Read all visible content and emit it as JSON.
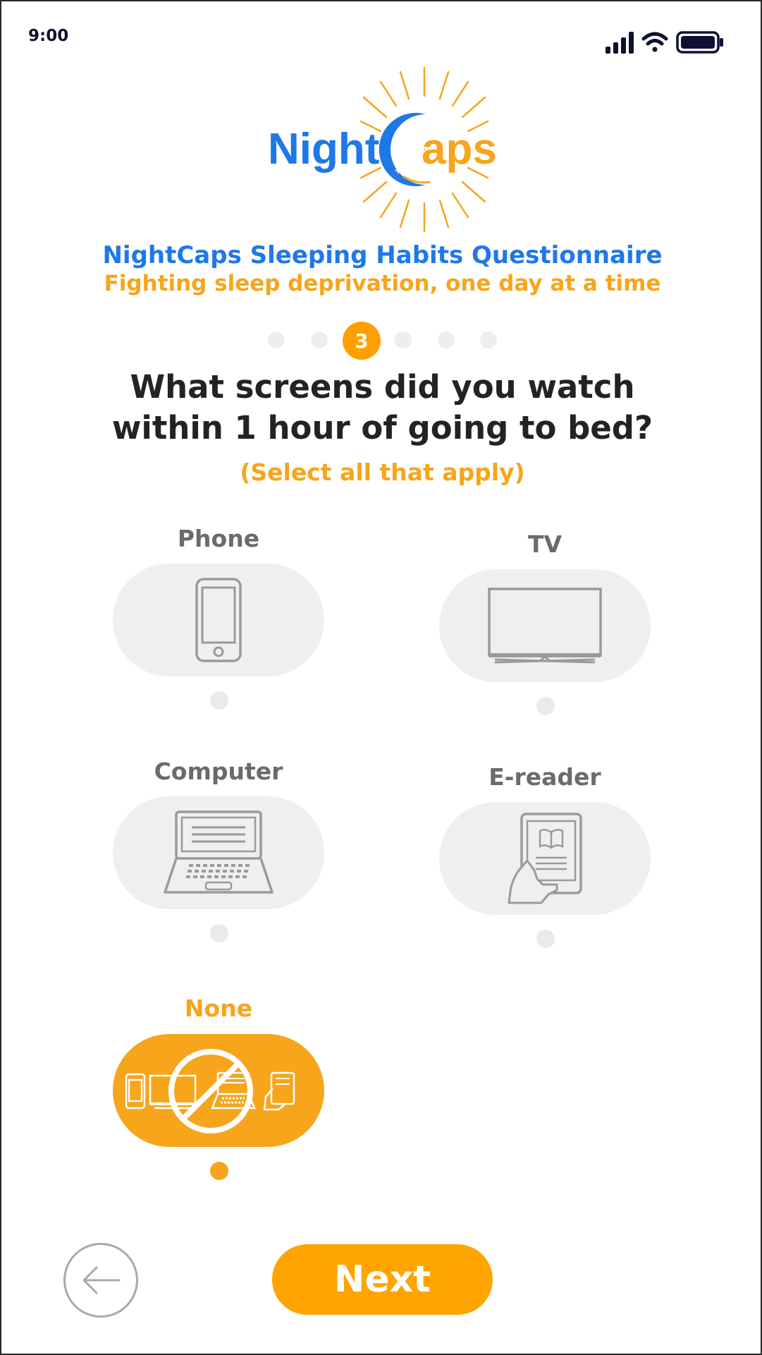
{
  "status_bar": {
    "time": "9:00",
    "icons": [
      "signal-icon",
      "wifi-icon",
      "battery-icon"
    ]
  },
  "logo": {
    "word_left": "Night",
    "word_right": "aps",
    "blue": "#1f78e8",
    "orange": "#f7a51b"
  },
  "header": {
    "title": "NightCaps Sleeping Habits Questionnaire",
    "subtitle": "Fighting sleep deprivation, one day at a time"
  },
  "progress": {
    "current_step": "3",
    "total_steps": 6,
    "active_index": 2
  },
  "question": {
    "line1": "What screens did you watch",
    "line2": "within 1 hour of going to bed?",
    "hint": "(Select all that apply)"
  },
  "options": [
    {
      "label": "Phone",
      "icon": "phone-icon",
      "selected": false
    },
    {
      "label": "TV",
      "icon": "tv-icon",
      "selected": false
    },
    {
      "label": "Computer",
      "icon": "laptop-icon",
      "selected": false
    },
    {
      "label": "E-reader",
      "icon": "e-reader-icon",
      "selected": false
    },
    {
      "label": "None",
      "icon": "no-screens-icon",
      "selected": true
    }
  ],
  "navigation": {
    "back_icon": "arrow-left-icon",
    "next_label": "Next"
  },
  "colors": {
    "accent": "#ffa400",
    "brand_blue": "#1f78e8",
    "option_bg": "#efefef",
    "icon_gray": "#9a9a9a",
    "text_dark": "#232323"
  }
}
